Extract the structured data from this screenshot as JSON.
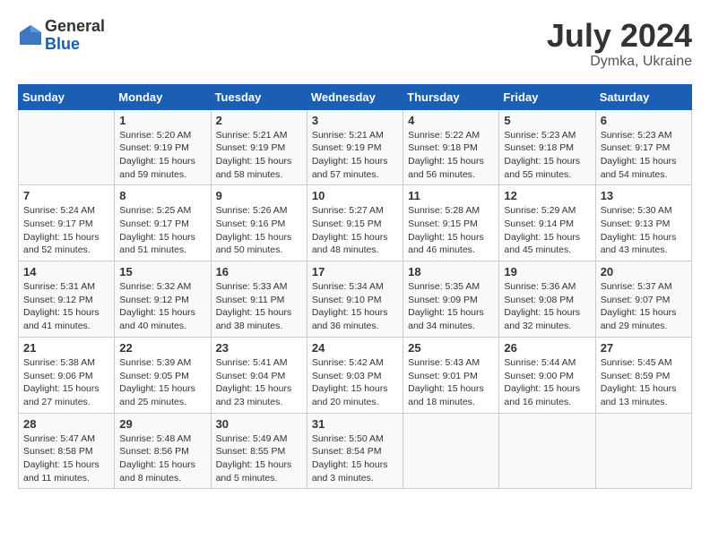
{
  "header": {
    "logo_general": "General",
    "logo_blue": "Blue",
    "month_year": "July 2024",
    "location": "Dymka, Ukraine"
  },
  "weekdays": [
    "Sunday",
    "Monday",
    "Tuesday",
    "Wednesday",
    "Thursday",
    "Friday",
    "Saturday"
  ],
  "weeks": [
    [
      {
        "day": "",
        "sunrise": "",
        "sunset": "",
        "daylight": ""
      },
      {
        "day": "1",
        "sunrise": "Sunrise: 5:20 AM",
        "sunset": "Sunset: 9:19 PM",
        "daylight": "Daylight: 15 hours and 59 minutes."
      },
      {
        "day": "2",
        "sunrise": "Sunrise: 5:21 AM",
        "sunset": "Sunset: 9:19 PM",
        "daylight": "Daylight: 15 hours and 58 minutes."
      },
      {
        "day": "3",
        "sunrise": "Sunrise: 5:21 AM",
        "sunset": "Sunset: 9:19 PM",
        "daylight": "Daylight: 15 hours and 57 minutes."
      },
      {
        "day": "4",
        "sunrise": "Sunrise: 5:22 AM",
        "sunset": "Sunset: 9:18 PM",
        "daylight": "Daylight: 15 hours and 56 minutes."
      },
      {
        "day": "5",
        "sunrise": "Sunrise: 5:23 AM",
        "sunset": "Sunset: 9:18 PM",
        "daylight": "Daylight: 15 hours and 55 minutes."
      },
      {
        "day": "6",
        "sunrise": "Sunrise: 5:23 AM",
        "sunset": "Sunset: 9:17 PM",
        "daylight": "Daylight: 15 hours and 54 minutes."
      }
    ],
    [
      {
        "day": "7",
        "sunrise": "Sunrise: 5:24 AM",
        "sunset": "Sunset: 9:17 PM",
        "daylight": "Daylight: 15 hours and 52 minutes."
      },
      {
        "day": "8",
        "sunrise": "Sunrise: 5:25 AM",
        "sunset": "Sunset: 9:17 PM",
        "daylight": "Daylight: 15 hours and 51 minutes."
      },
      {
        "day": "9",
        "sunrise": "Sunrise: 5:26 AM",
        "sunset": "Sunset: 9:16 PM",
        "daylight": "Daylight: 15 hours and 50 minutes."
      },
      {
        "day": "10",
        "sunrise": "Sunrise: 5:27 AM",
        "sunset": "Sunset: 9:15 PM",
        "daylight": "Daylight: 15 hours and 48 minutes."
      },
      {
        "day": "11",
        "sunrise": "Sunrise: 5:28 AM",
        "sunset": "Sunset: 9:15 PM",
        "daylight": "Daylight: 15 hours and 46 minutes."
      },
      {
        "day": "12",
        "sunrise": "Sunrise: 5:29 AM",
        "sunset": "Sunset: 9:14 PM",
        "daylight": "Daylight: 15 hours and 45 minutes."
      },
      {
        "day": "13",
        "sunrise": "Sunrise: 5:30 AM",
        "sunset": "Sunset: 9:13 PM",
        "daylight": "Daylight: 15 hours and 43 minutes."
      }
    ],
    [
      {
        "day": "14",
        "sunrise": "Sunrise: 5:31 AM",
        "sunset": "Sunset: 9:12 PM",
        "daylight": "Daylight: 15 hours and 41 minutes."
      },
      {
        "day": "15",
        "sunrise": "Sunrise: 5:32 AM",
        "sunset": "Sunset: 9:12 PM",
        "daylight": "Daylight: 15 hours and 40 minutes."
      },
      {
        "day": "16",
        "sunrise": "Sunrise: 5:33 AM",
        "sunset": "Sunset: 9:11 PM",
        "daylight": "Daylight: 15 hours and 38 minutes."
      },
      {
        "day": "17",
        "sunrise": "Sunrise: 5:34 AM",
        "sunset": "Sunset: 9:10 PM",
        "daylight": "Daylight: 15 hours and 36 minutes."
      },
      {
        "day": "18",
        "sunrise": "Sunrise: 5:35 AM",
        "sunset": "Sunset: 9:09 PM",
        "daylight": "Daylight: 15 hours and 34 minutes."
      },
      {
        "day": "19",
        "sunrise": "Sunrise: 5:36 AM",
        "sunset": "Sunset: 9:08 PM",
        "daylight": "Daylight: 15 hours and 32 minutes."
      },
      {
        "day": "20",
        "sunrise": "Sunrise: 5:37 AM",
        "sunset": "Sunset: 9:07 PM",
        "daylight": "Daylight: 15 hours and 29 minutes."
      }
    ],
    [
      {
        "day": "21",
        "sunrise": "Sunrise: 5:38 AM",
        "sunset": "Sunset: 9:06 PM",
        "daylight": "Daylight: 15 hours and 27 minutes."
      },
      {
        "day": "22",
        "sunrise": "Sunrise: 5:39 AM",
        "sunset": "Sunset: 9:05 PM",
        "daylight": "Daylight: 15 hours and 25 minutes."
      },
      {
        "day": "23",
        "sunrise": "Sunrise: 5:41 AM",
        "sunset": "Sunset: 9:04 PM",
        "daylight": "Daylight: 15 hours and 23 minutes."
      },
      {
        "day": "24",
        "sunrise": "Sunrise: 5:42 AM",
        "sunset": "Sunset: 9:03 PM",
        "daylight": "Daylight: 15 hours and 20 minutes."
      },
      {
        "day": "25",
        "sunrise": "Sunrise: 5:43 AM",
        "sunset": "Sunset: 9:01 PM",
        "daylight": "Daylight: 15 hours and 18 minutes."
      },
      {
        "day": "26",
        "sunrise": "Sunrise: 5:44 AM",
        "sunset": "Sunset: 9:00 PM",
        "daylight": "Daylight: 15 hours and 16 minutes."
      },
      {
        "day": "27",
        "sunrise": "Sunrise: 5:45 AM",
        "sunset": "Sunset: 8:59 PM",
        "daylight": "Daylight: 15 hours and 13 minutes."
      }
    ],
    [
      {
        "day": "28",
        "sunrise": "Sunrise: 5:47 AM",
        "sunset": "Sunset: 8:58 PM",
        "daylight": "Daylight: 15 hours and 11 minutes."
      },
      {
        "day": "29",
        "sunrise": "Sunrise: 5:48 AM",
        "sunset": "Sunset: 8:56 PM",
        "daylight": "Daylight: 15 hours and 8 minutes."
      },
      {
        "day": "30",
        "sunrise": "Sunrise: 5:49 AM",
        "sunset": "Sunset: 8:55 PM",
        "daylight": "Daylight: 15 hours and 5 minutes."
      },
      {
        "day": "31",
        "sunrise": "Sunrise: 5:50 AM",
        "sunset": "Sunset: 8:54 PM",
        "daylight": "Daylight: 15 hours and 3 minutes."
      },
      {
        "day": "",
        "sunrise": "",
        "sunset": "",
        "daylight": ""
      },
      {
        "day": "",
        "sunrise": "",
        "sunset": "",
        "daylight": ""
      },
      {
        "day": "",
        "sunrise": "",
        "sunset": "",
        "daylight": ""
      }
    ]
  ]
}
